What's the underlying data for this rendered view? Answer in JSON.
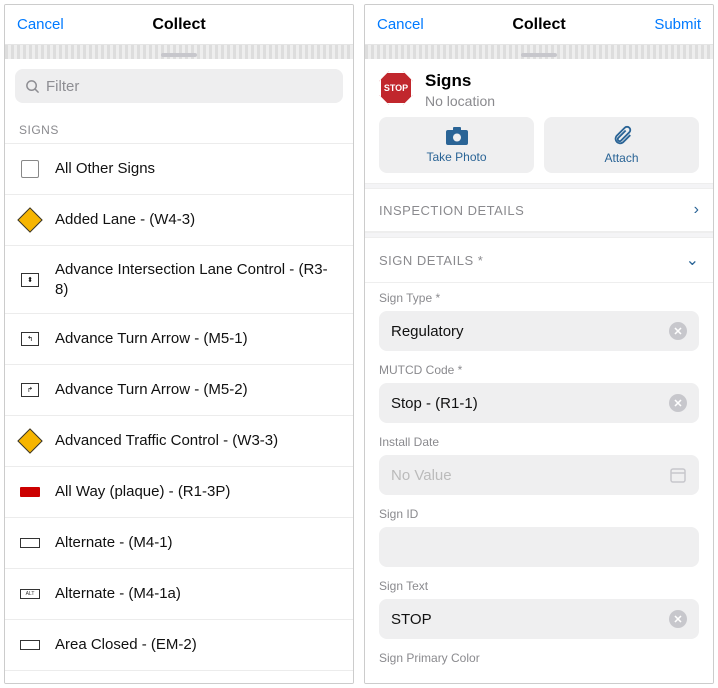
{
  "left": {
    "cancel": "Cancel",
    "title": "Collect",
    "filterPlaceholder": "Filter",
    "sectionLabel": "SIGNS",
    "rows": [
      "All Other Signs",
      "Added Lane - (W4-3)",
      "Advance Intersection Lane Control - (R3-8)",
      "Advance Turn Arrow - (M5-1)",
      "Advance Turn Arrow - (M5-2)",
      "Advanced Traffic Control - (W3-3)",
      "All Way (plaque) - (R1-3P)",
      "Alternate - (M4-1)",
      "Alternate - (M4-1a)",
      "Area Closed - (EM-2)"
    ]
  },
  "right": {
    "cancel": "Cancel",
    "title": "Collect",
    "submit": "Submit",
    "headerTitle": "Signs",
    "headerSub": "No location",
    "stopText": "STOP",
    "takePhoto": "Take Photo",
    "attach": "Attach",
    "sectionInspection": "INSPECTION DETAILS",
    "sectionSign": "SIGN DETAILS *",
    "fields": {
      "signTypeLabel": "Sign Type *",
      "signTypeValue": "Regulatory",
      "mutcdLabel": "MUTCD Code *",
      "mutcdValue": "Stop - (R1-1)",
      "installLabel": "Install Date",
      "installValue": "No Value",
      "idLabel": "Sign ID",
      "textLabel": "Sign Text",
      "textValue": "STOP",
      "colorLabel": "Sign Primary Color"
    }
  }
}
